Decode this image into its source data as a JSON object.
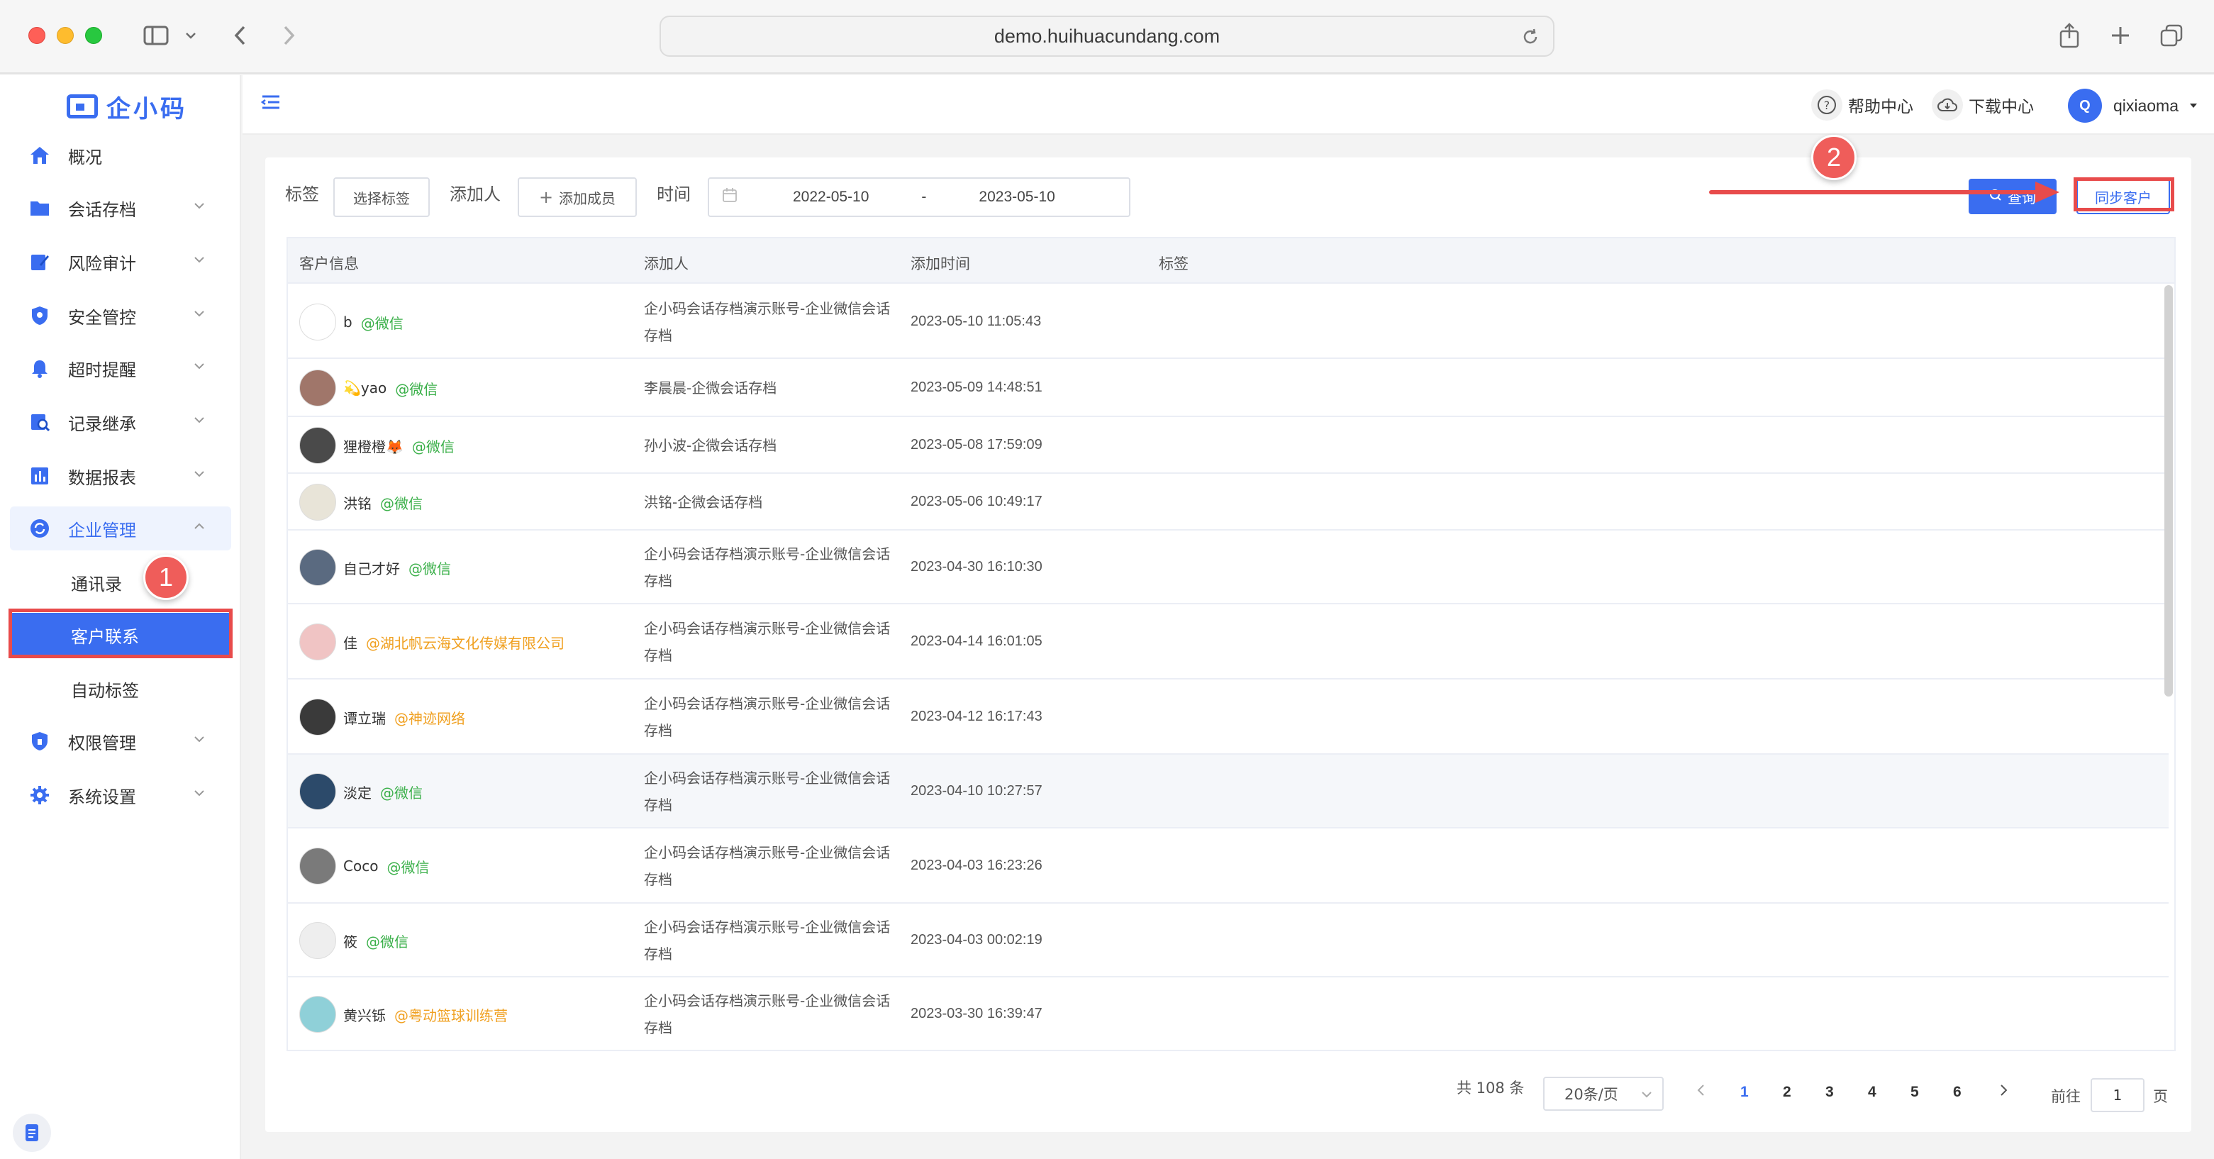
{
  "browser": {
    "url": "demo.huihuacundang.com"
  },
  "app": {
    "logo_text": "企小码"
  },
  "sidebar": {
    "items": [
      {
        "label": "概况",
        "icon": "home-icon"
      },
      {
        "label": "会话存档",
        "icon": "folder-icon"
      },
      {
        "label": "风险审计",
        "icon": "edit-icon"
      },
      {
        "label": "安全管控",
        "icon": "shield-icon"
      },
      {
        "label": "超时提醒",
        "icon": "bell-icon"
      },
      {
        "label": "记录继承",
        "icon": "user-search-icon"
      },
      {
        "label": "数据报表",
        "icon": "bar-chart-icon"
      },
      {
        "label": "企业管理",
        "icon": "refresh-icon"
      },
      {
        "label": "权限管理",
        "icon": "shield-lock-icon"
      },
      {
        "label": "系统设置",
        "icon": "gear-icon"
      }
    ],
    "sub_items": [
      {
        "label": "通讯录"
      },
      {
        "label": "客户联系"
      },
      {
        "label": "自动标签"
      }
    ]
  },
  "header": {
    "help_label": "帮助中心",
    "download_label": "下载中心",
    "user_initial": "Q",
    "user_name": "qixiaoma"
  },
  "filters": {
    "tag_label": "标签",
    "tag_button": "选择标签",
    "adder_label": "添加人",
    "adder_button": "添加成员",
    "time_label": "时间",
    "date_start": "2022-05-10",
    "date_sep": "-",
    "date_end": "2023-05-10",
    "query_button": "查询",
    "sync_button": "同步客户"
  },
  "annotations": {
    "badge_1": "1",
    "badge_2": "2"
  },
  "table": {
    "headers": [
      "客户信息",
      "添加人",
      "添加时间",
      "标签"
    ],
    "rows": [
      {
        "name": "b",
        "source": "@微信",
        "source_type": "wechat",
        "adder": "企小码会话存档演示账号-企业微信会话存档",
        "time": "2023-05-10 11:05:43",
        "avatar_color": "#ffffff"
      },
      {
        "name": "💫yao",
        "source": "@微信",
        "source_type": "wechat",
        "adder": "李晨晨-企微会话存档",
        "time": "2023-05-09 14:48:51",
        "avatar_color": "#a0766a"
      },
      {
        "name": "狸橙橙🦊",
        "source": "@微信",
        "source_type": "wechat",
        "adder": "孙小波-企微会话存档",
        "time": "2023-05-08 17:59:09",
        "avatar_color": "#4a4a4a"
      },
      {
        "name": "洪铭",
        "source": "@微信",
        "source_type": "wechat",
        "adder": "洪铭-企微会话存档",
        "time": "2023-05-06 10:49:17",
        "avatar_color": "#e8e4d8"
      },
      {
        "name": "自己才好",
        "source": "@微信",
        "source_type": "wechat",
        "adder": "企小码会话存档演示账号-企业微信会话存档",
        "time": "2023-04-30 16:10:30",
        "avatar_color": "#5a6a80"
      },
      {
        "name": "佳",
        "source": "@湖北帆云海文化传媒有限公司",
        "source_type": "org",
        "adder": "企小码会话存档演示账号-企业微信会话存档",
        "time": "2023-04-14 16:01:05",
        "avatar_color": "#f0c4c4"
      },
      {
        "name": "谭立瑞",
        "source": "@神迹网络",
        "source_type": "org",
        "adder": "企小码会话存档演示账号-企业微信会话存档",
        "time": "2023-04-12 16:17:43",
        "avatar_color": "#3a3a3a"
      },
      {
        "name": "淡定",
        "source": "@微信",
        "source_type": "wechat",
        "adder": "企小码会话存档演示账号-企业微信会话存档",
        "time": "2023-04-10 10:27:57",
        "avatar_color": "#2c4a6a"
      },
      {
        "name": "Coco",
        "source": "@微信",
        "source_type": "wechat",
        "adder": "企小码会话存档演示账号-企业微信会话存档",
        "time": "2023-04-03 16:23:26",
        "avatar_color": "#7a7a7a"
      },
      {
        "name": "筱",
        "source": "@微信",
        "source_type": "wechat",
        "adder": "企小码会话存档演示账号-企业微信会话存档",
        "time": "2023-04-03 00:02:19",
        "avatar_color": "#eeeeee"
      },
      {
        "name": "黄兴铄",
        "source": "@粤动篮球训练营",
        "source_type": "org",
        "adder": "企小码会话存档演示账号-企业微信会话存档",
        "time": "2023-03-30 16:39:47",
        "avatar_color": "#8fd0d8"
      }
    ]
  },
  "pagination": {
    "total": "共 108 条",
    "page_size": "20条/页",
    "pages": [
      "1",
      "2",
      "3",
      "4",
      "5",
      "6"
    ],
    "current_page": "1",
    "goto_prefix": "前往",
    "goto_value": "1",
    "goto_suffix": "页"
  },
  "colors": {
    "primary": "#3a6df0",
    "wechat_green": "#3bb04a",
    "org_orange": "#f0a020",
    "annotation_red": "#e84b4b"
  }
}
